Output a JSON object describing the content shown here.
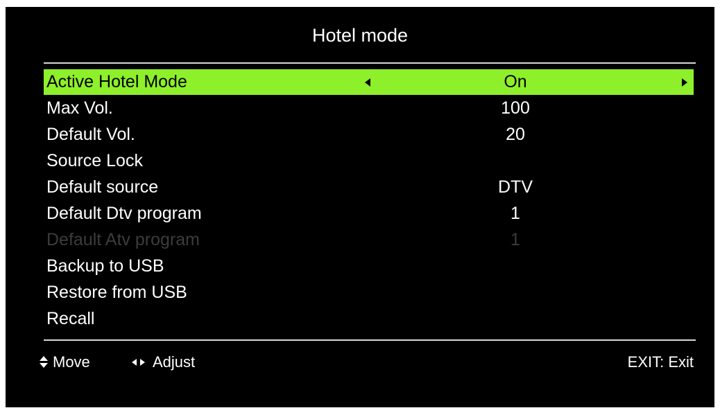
{
  "title": "Hotel mode",
  "colors": {
    "background": "#000000",
    "text": "#ffffff",
    "highlight": "#8ef02a",
    "disabled_text": "#3c3c3c"
  },
  "menu": {
    "items": [
      {
        "label": "Active Hotel Mode",
        "value": "On",
        "selected": true,
        "disabled": false
      },
      {
        "label": "Max Vol.",
        "value": "100",
        "selected": false,
        "disabled": false
      },
      {
        "label": "Default Vol.",
        "value": "20",
        "selected": false,
        "disabled": false
      },
      {
        "label": "Source Lock",
        "value": "",
        "selected": false,
        "disabled": false
      },
      {
        "label": "Default source",
        "value": "DTV",
        "selected": false,
        "disabled": false
      },
      {
        "label": "Default Dtv program",
        "value": "1",
        "selected": false,
        "disabled": false
      },
      {
        "label": "Default Atv program",
        "value": "1",
        "selected": false,
        "disabled": true
      },
      {
        "label": "Backup to USB",
        "value": "",
        "selected": false,
        "disabled": false
      },
      {
        "label": "Restore from USB",
        "value": "",
        "selected": false,
        "disabled": false
      },
      {
        "label": "Recall",
        "value": "",
        "selected": false,
        "disabled": false
      }
    ]
  },
  "footer": {
    "move_label": "Move",
    "move_icon": "up-down-arrows-icon",
    "adjust_label": "Adjust",
    "adjust_icon": "left-right-arrows-icon",
    "exit_label": "EXIT: Exit"
  }
}
